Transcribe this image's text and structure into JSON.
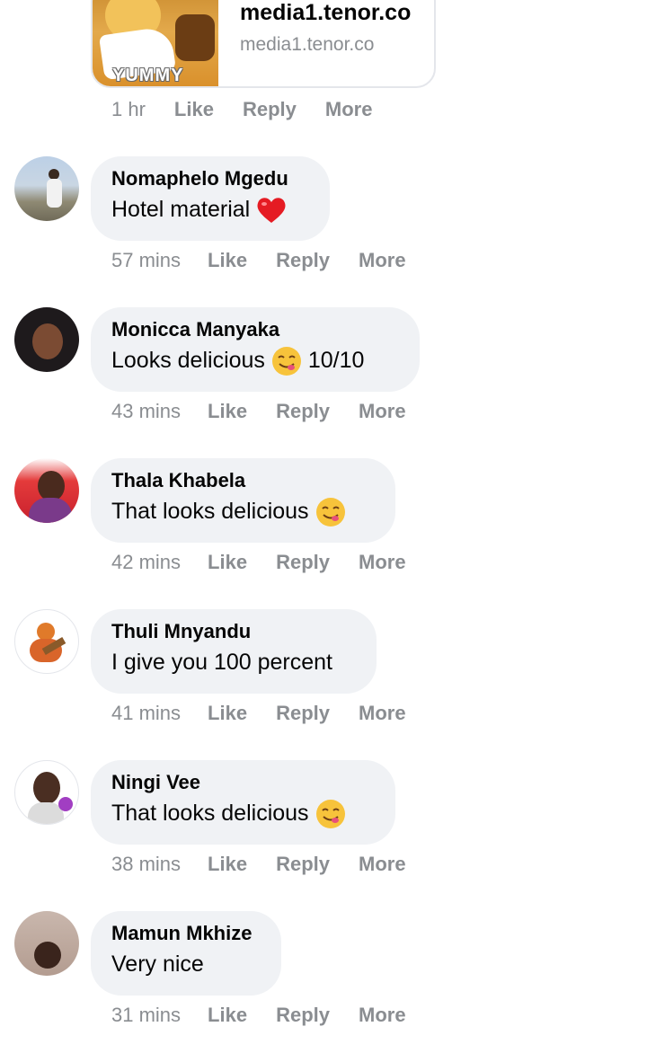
{
  "link_preview": {
    "title": "media1.tenor.co",
    "domain": "media1.tenor.co",
    "gif_caption": "YUMMY",
    "time": "1 hr",
    "like": "Like",
    "reply": "Reply",
    "more": "More"
  },
  "comments": [
    {
      "author": "Nomaphelo Mgedu",
      "text": "Hotel material",
      "emoji": "heart-icon",
      "time": "57 mins",
      "like": "Like",
      "reply": "Reply",
      "more": "More"
    },
    {
      "author": "Monicca Manyaka",
      "text": "Looks delicious",
      "emoji": "yum-face-icon",
      "text_after": "10/10",
      "time": "43 mins",
      "like": "Like",
      "reply": "Reply",
      "more": "More"
    },
    {
      "author": "Thala Khabela",
      "text": "That looks delicious",
      "emoji": "yum-face-icon",
      "time": "42 mins",
      "like": "Like",
      "reply": "Reply",
      "more": "More"
    },
    {
      "author": "Thuli Mnyandu",
      "text": "I give you 100 percent",
      "time": "41 mins",
      "like": "Like",
      "reply": "Reply",
      "more": "More"
    },
    {
      "author": "Ningi Vee",
      "text": "That looks delicious",
      "emoji": "yum-face-icon",
      "time": "38 mins",
      "like": "Like",
      "reply": "Reply",
      "more": "More"
    },
    {
      "author": "Mamun Mkhize",
      "text": "Very nice",
      "time": "31 mins",
      "like": "Like",
      "reply": "Reply",
      "more": "More"
    }
  ],
  "colors": {
    "bubble": "#f0f2f5",
    "meta": "#8a8d91",
    "text": "#050505"
  }
}
